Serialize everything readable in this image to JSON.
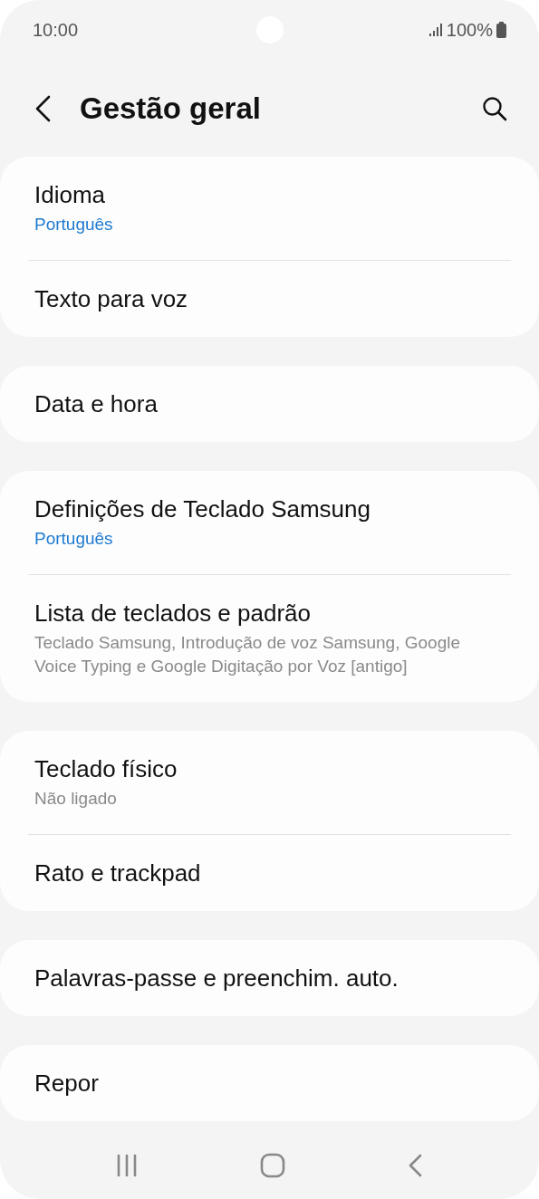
{
  "status_bar": {
    "time": "10:00",
    "battery": "100%"
  },
  "header": {
    "title": "Gestão geral"
  },
  "groups": [
    {
      "items": [
        {
          "title": "Idioma",
          "summary": "Português",
          "kind": "value"
        },
        {
          "title": "Texto para voz"
        }
      ]
    },
    {
      "items": [
        {
          "title": "Data e hora"
        }
      ]
    },
    {
      "items": [
        {
          "title": "Definições de Teclado Samsung",
          "summary": "Português",
          "kind": "value"
        },
        {
          "title": "Lista de teclados e padrão",
          "summary": "Teclado Samsung, Introdução de voz Samsung, Google Voice Typing e Google Digitação por Voz [antigo]",
          "kind": "description"
        }
      ]
    },
    {
      "items": [
        {
          "title": "Teclado físico",
          "summary": "Não ligado",
          "kind": "description"
        },
        {
          "title": "Rato e trackpad"
        }
      ]
    },
    {
      "items": [
        {
          "title": "Palavras-passe e preenchim. auto."
        }
      ]
    },
    {
      "items": [
        {
          "title": "Repor"
        }
      ]
    }
  ]
}
